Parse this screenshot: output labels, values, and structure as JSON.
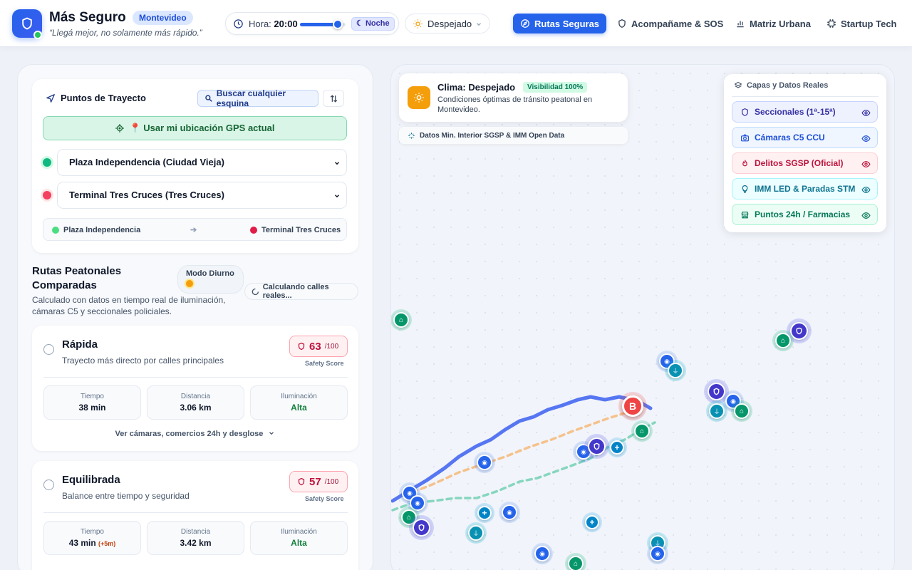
{
  "app": {
    "title": "Más Seguro",
    "city": "Montevideo",
    "tagline": "“Llegá mejor, no solamente más rápido.”"
  },
  "time_control": {
    "label": "Hora:",
    "value": "20:00",
    "slider_fraction": 0.83,
    "mode_badge": "Noche"
  },
  "weather_select": {
    "value": "Despejado"
  },
  "nav": [
    {
      "label": "Rutas Seguras",
      "icon": "compass-icon",
      "active": true
    },
    {
      "label": "Acompañame & SOS",
      "icon": "shield-icon",
      "active": false
    },
    {
      "label": "Matriz Urbana",
      "icon": "bar-chart-icon",
      "active": false
    },
    {
      "label": "Startup Tech",
      "icon": "chip-icon",
      "active": false
    }
  ],
  "trip": {
    "title": "Puntos de Trayecto",
    "search_label": "Buscar cualquier esquina",
    "gps_label": "📍 Usar mi ubicación GPS actual",
    "origin": "Plaza Independencia (Ciudad Vieja)",
    "destination": "Terminal Tres Cruces (Tres Cruces)",
    "summary_from": "Plaza Independencia",
    "summary_arrow": "➔",
    "summary_to": "Terminal Tres Cruces"
  },
  "routes_section": {
    "title": "Rutas Peatonales Comparadas",
    "mode_badge": "Modo Diurno",
    "calc_badge": "Calculando calles reales...",
    "subtitle": "Calculado con datos en tiempo real de iluminación, cámaras C5 y seccionales policiales."
  },
  "route_cards": [
    {
      "name": "Rápida",
      "desc": "Trayecto más directo por calles principales",
      "score": "63",
      "score_max": "/100",
      "score_label": "Safety Score",
      "time_label": "Tiempo",
      "time": "38 min",
      "time_extra": "",
      "dist_label": "Distancia",
      "dist": "3.06 km",
      "light_label": "Iluminación",
      "light": "Alta",
      "more": "Ver cámaras, comercios 24h y desglose"
    },
    {
      "name": "Equilibrada",
      "desc": "Balance entre tiempo y seguridad",
      "score": "57",
      "score_max": "/100",
      "score_label": "Safety Score",
      "time_label": "Tiempo",
      "time": "43 min",
      "time_extra": "(+5m)",
      "dist_label": "Distancia",
      "dist": "3.42 km",
      "light_label": "Iluminación",
      "light": "Alta",
      "more": ""
    }
  ],
  "map": {
    "weather_title": "Clima: Despejado",
    "weather_visibility": "Visibilidad 100%",
    "weather_desc": "Condiciones óptimas de tránsito peatonal en Montevideo.",
    "source_label": "Datos Min. Interior SGSP & IMM Open Data",
    "destination_marker": "B",
    "layers_title": "Capas y Datos Reales",
    "layers": [
      {
        "label": "Seccionales (1ª-15ª)",
        "icon": "shield-icon",
        "color": "#3730a3",
        "bg": "#eef2ff",
        "border": "#c7d2fe"
      },
      {
        "label": "Cámaras C5 CCU",
        "icon": "camera-icon",
        "color": "#1d4ed8",
        "bg": "#eff6ff",
        "border": "#bfdbfe"
      },
      {
        "label": "Delitos SGSP (Oficial)",
        "icon": "flame-icon",
        "color": "#be123c",
        "bg": "#fff1f2",
        "border": "#fecdd3"
      },
      {
        "label": "IMM LED & Paradas STM",
        "icon": "bulb-icon",
        "color": "#0e7490",
        "bg": "#ecfeff",
        "border": "#a5f3fc"
      },
      {
        "label": "Puntos 24h / Farmacias",
        "icon": "store-icon",
        "color": "#047857",
        "bg": "#ecfdf5",
        "border": "#a7f3d0"
      }
    ]
  },
  "colors": {
    "accent": "#2563eb",
    "fast_route": "#3b5ff0",
    "balanced_route": "#f5c28c",
    "safe_route": "#86d6bf"
  }
}
